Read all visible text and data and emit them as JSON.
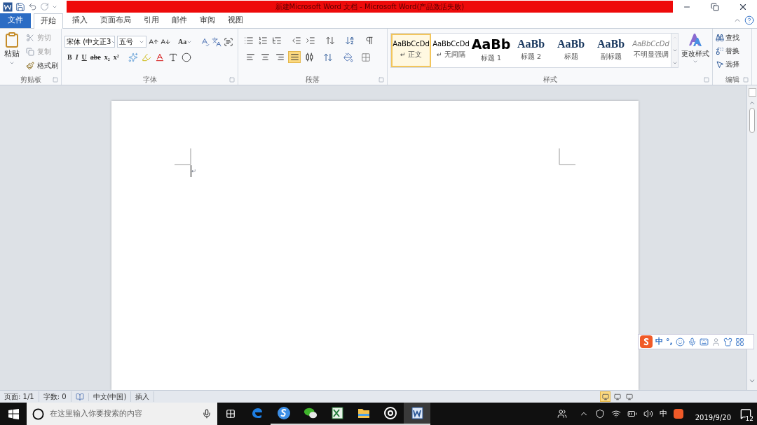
{
  "window": {
    "title": "新建Microsoft Word 文档 - Microsoft Word(产品激活失败)"
  },
  "tabs": [
    {
      "label": "文件",
      "selected": false,
      "kind": "file"
    },
    {
      "label": "开始",
      "selected": true,
      "kind": "tab"
    },
    {
      "label": "插入",
      "selected": false,
      "kind": "tab"
    },
    {
      "label": "页面布局",
      "selected": false,
      "kind": "tab"
    },
    {
      "label": "引用",
      "selected": false,
      "kind": "tab"
    },
    {
      "label": "邮件",
      "selected": false,
      "kind": "tab"
    },
    {
      "label": "审阅",
      "selected": false,
      "kind": "tab"
    },
    {
      "label": "视图",
      "selected": false,
      "kind": "tab"
    }
  ],
  "clipboard": {
    "paste": "粘贴",
    "group_label": "剪贴板",
    "items": [
      {
        "label": "剪切",
        "disabled": true,
        "kind": "cut"
      },
      {
        "label": "复制",
        "disabled": true,
        "kind": "copy"
      },
      {
        "label": "格式刷",
        "disabled": false,
        "kind": "brush"
      }
    ]
  },
  "font": {
    "font_name": "宋体 (中文正3",
    "font_size": "五号",
    "change_case": "Aa",
    "group_label": "字体",
    "format": [
      "B",
      "I",
      "U",
      "abe",
      "x₂",
      "x²"
    ]
  },
  "paragraph": {
    "group_label": "段落",
    "alignment": [
      {
        "selected": false
      },
      {
        "selected": false
      },
      {
        "selected": false
      },
      {
        "selected": true
      },
      {
        "selected": false
      }
    ]
  },
  "styles": {
    "group_label": "样式",
    "change_styles": "更改样式",
    "items": [
      {
        "sample": "AaBbCcDd",
        "label": "↵ 正文",
        "selected": true,
        "kind": "normal"
      },
      {
        "sample": "AaBbCcDd",
        "label": "↵ 无间隔",
        "selected": false,
        "kind": "normal"
      },
      {
        "sample": "AaBb",
        "label": "标题 1",
        "selected": false,
        "kind": "h1"
      },
      {
        "sample": "AaBb",
        "label": "标题 2",
        "selected": false,
        "kind": "h2"
      },
      {
        "sample": "AaBb",
        "label": "标题",
        "selected": false,
        "kind": "h2"
      },
      {
        "sample": "AaBb",
        "label": "副标题",
        "selected": false,
        "kind": "h2"
      },
      {
        "sample": "AaBbCcDd",
        "label": "不明显强调",
        "selected": false,
        "kind": "emphasis"
      }
    ]
  },
  "editing": {
    "group_label": "编辑",
    "items": [
      {
        "label": "查找",
        "kind": "find"
      },
      {
        "label": "替换",
        "kind": "replace"
      },
      {
        "label": "选择",
        "kind": "select"
      }
    ]
  },
  "document": {
    "paragraph_mark": "↵"
  },
  "ime_toolbar": {
    "mode": "中",
    "punctuation": "°,"
  },
  "status_bar": {
    "items": [
      {
        "kind": "text",
        "text": "页面: 1/1"
      },
      {
        "kind": "text",
        "text": "字数: 0"
      },
      {
        "kind": "proofing"
      },
      {
        "kind": "text",
        "text": "中文(中国)"
      },
      {
        "kind": "text",
        "text": "插入"
      }
    ],
    "views": [
      {
        "selected": true
      },
      {
        "selected": false
      },
      {
        "selected": false
      }
    ]
  },
  "taskbar": {
    "search_placeholder": "在这里输入你要搜索的内容",
    "apps": [
      {
        "kind": "edge",
        "running": false,
        "active": false
      },
      {
        "kind": "sogou",
        "running": true,
        "active": false
      },
      {
        "kind": "wechat",
        "running": true,
        "active": false
      },
      {
        "kind": "excel",
        "running": true,
        "active": false
      },
      {
        "kind": "folder",
        "running": true,
        "active": false
      },
      {
        "kind": "groove",
        "running": true,
        "active": false
      },
      {
        "kind": "word",
        "running": true,
        "active": true
      }
    ],
    "ime": "中",
    "date": "2019/9/20",
    "notifications": "12"
  }
}
